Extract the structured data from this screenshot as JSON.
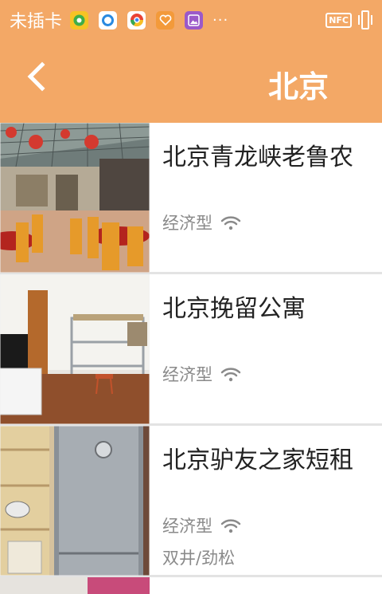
{
  "status_bar": {
    "carrier": "未插卡",
    "overflow_indicator": "···",
    "nfc_label": "NFC",
    "icons": [
      "app-icon-green",
      "app-icon-blue",
      "app-icon-chrome",
      "app-icon-heart",
      "app-icon-gallery",
      "vibrate-icon"
    ]
  },
  "header": {
    "title": "北京",
    "back_icon": "chevron-left-icon"
  },
  "colors": {
    "accent": "#f3a866",
    "text": "#222222",
    "meta": "#8a8a8a"
  },
  "listings": [
    {
      "name": "北京青龙峡老鲁农",
      "type": "经济型",
      "area": ""
    },
    {
      "name": "北京挽留公寓",
      "type": "经济型",
      "area": ""
    },
    {
      "name": "北京驴友之家短租",
      "type": "经济型",
      "area": "双井/劲松"
    }
  ]
}
